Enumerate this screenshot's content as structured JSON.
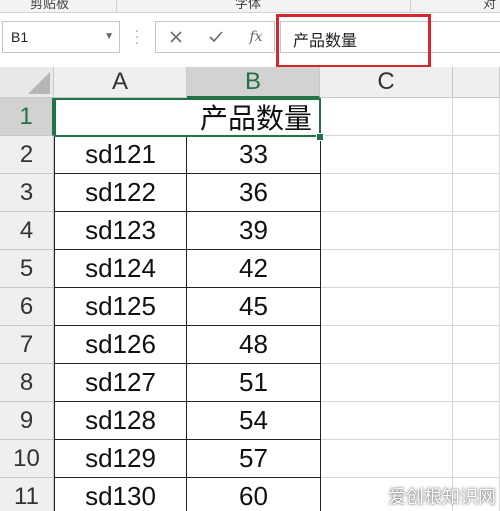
{
  "ribbon": {
    "groups": [
      "剪贴板",
      "字体",
      "对"
    ]
  },
  "formula_bar": {
    "name_box": "B1",
    "cancel_icon": "close-icon",
    "enter_icon": "check-icon",
    "fx_label": "fx",
    "content": "产品数量"
  },
  "columns": [
    "A",
    "B",
    "C"
  ],
  "rows": [
    "1",
    "2",
    "3",
    "4",
    "5",
    "6",
    "7",
    "8",
    "9",
    "10",
    "11"
  ],
  "sheet": {
    "title": "产品数量",
    "data": [
      {
        "name": "sd121",
        "qty": "33"
      },
      {
        "name": "sd122",
        "qty": "36"
      },
      {
        "name": "sd123",
        "qty": "39"
      },
      {
        "name": "sd124",
        "qty": "42"
      },
      {
        "name": "sd125",
        "qty": "45"
      },
      {
        "name": "sd126",
        "qty": "48"
      },
      {
        "name": "sd127",
        "qty": "51"
      },
      {
        "name": "sd128",
        "qty": "54"
      },
      {
        "name": "sd129",
        "qty": "57"
      },
      {
        "name": "sd130",
        "qty": "60"
      }
    ]
  },
  "watermark": "爱创根知识网",
  "colors": {
    "selection": "#217346",
    "highlight": "#d9262c"
  }
}
